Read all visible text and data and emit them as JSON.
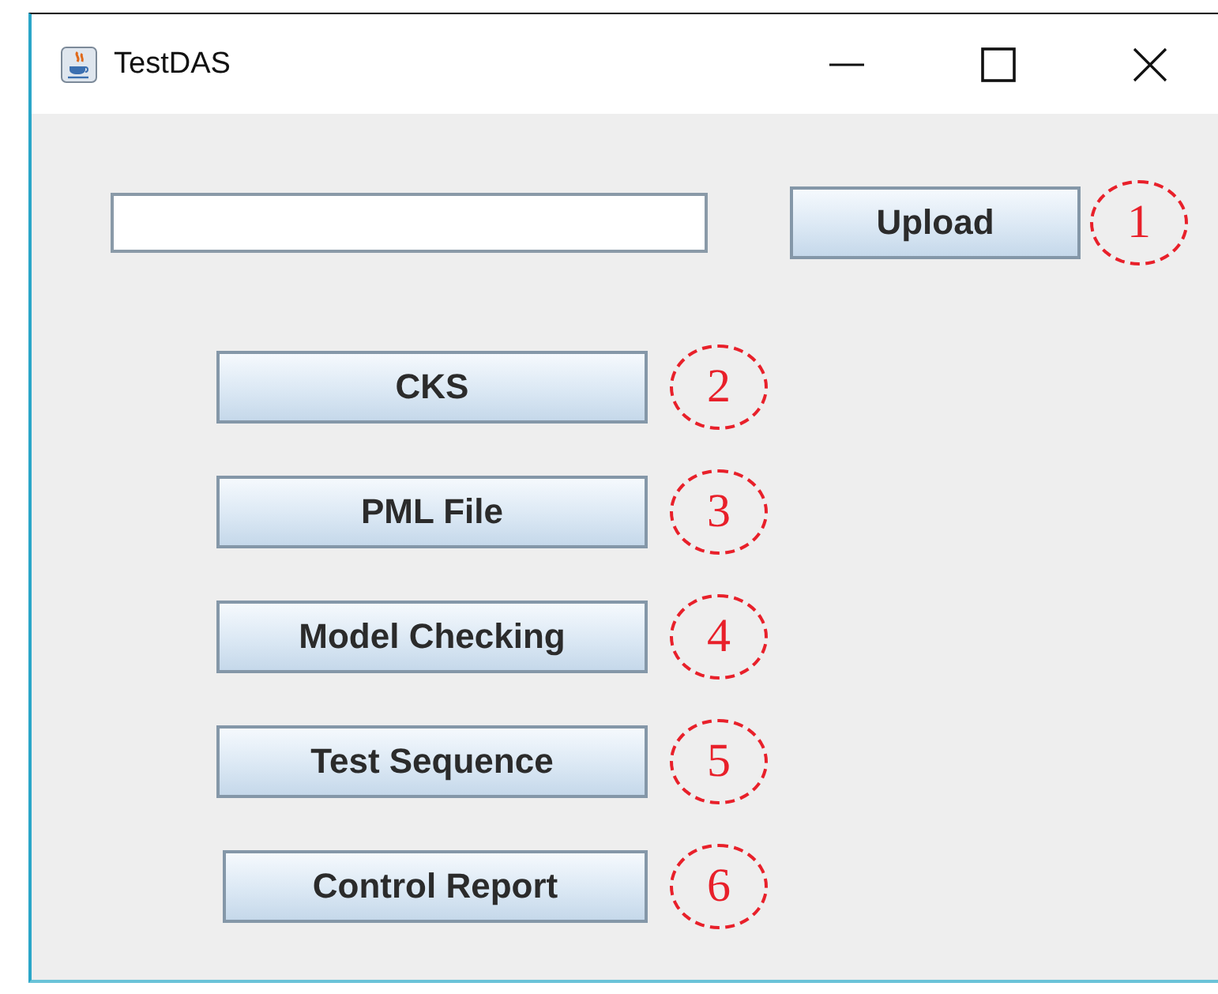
{
  "window": {
    "title": "TestDAS"
  },
  "upload": {
    "label": "Upload",
    "callout": "1"
  },
  "buttons": [
    {
      "label": "CKS",
      "callout": "2"
    },
    {
      "label": "PML File",
      "callout": "3"
    },
    {
      "label": "Model Checking",
      "callout": "4"
    },
    {
      "label": "Test Sequence",
      "callout": "5"
    },
    {
      "label": "Control Report",
      "callout": "6"
    }
  ]
}
